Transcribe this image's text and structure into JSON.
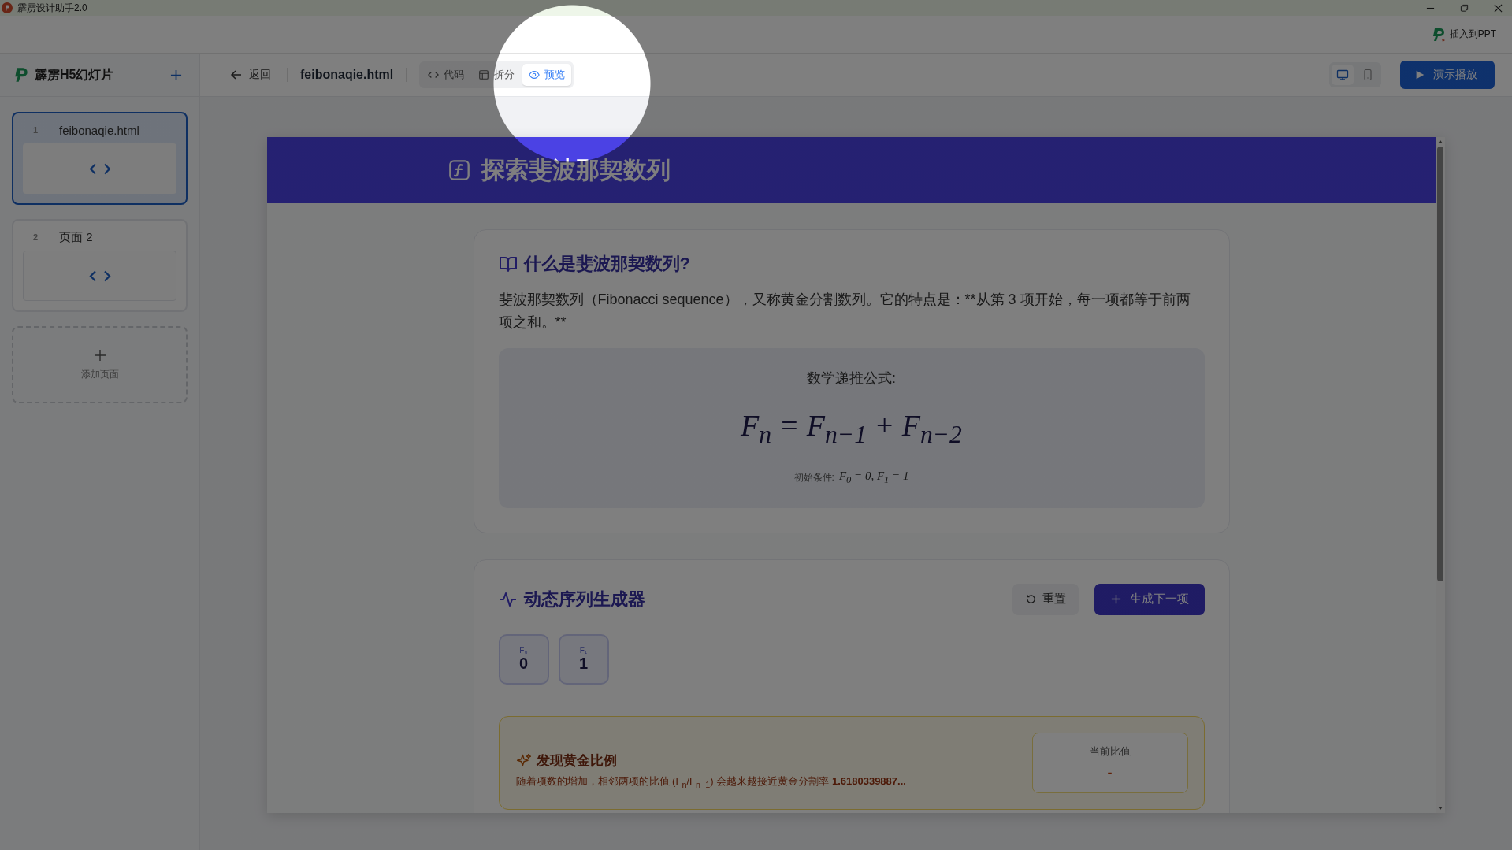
{
  "window": {
    "title": "霹雳设计助手2.0"
  },
  "top_bar": {
    "insert_button": "插入到PPT"
  },
  "sidebar": {
    "title": "霹雳H5幻灯片",
    "pages": [
      {
        "number": "1",
        "name": "feibonaqie.html",
        "selected": true
      },
      {
        "number": "2",
        "name": "页面 2",
        "selected": false
      }
    ],
    "add_page": "添加页面"
  },
  "toolbar": {
    "back": "返回",
    "filename": "feibonaqie.html",
    "view_tabs": [
      {
        "kind": "code",
        "label": "代码",
        "selected": false
      },
      {
        "kind": "split",
        "label": "拆分",
        "selected": false
      },
      {
        "kind": "preview",
        "label": "预览",
        "selected": true
      }
    ],
    "devices": [
      {
        "kind": "desktop",
        "selected": true
      },
      {
        "kind": "mobile",
        "selected": false
      }
    ],
    "play_button": "演示播放"
  },
  "slide": {
    "title": "探索斐波那契数列",
    "intro": {
      "heading": "什么是斐波那契数列?",
      "paragraph": "斐波那契数列（Fibonacci sequence），又称黄金分割数列。它的特点是：**从第 3 项开始，每一项都等于前两项之和。**",
      "formula_label": "数学递推公式:",
      "formula": "F$_{n}$ = F$_{n−1}$ + F$_{n−2}$",
      "initial_label": "初始条件:",
      "initial": "F$_{0}$ = 0, F$_{1}$ = 1"
    },
    "generator": {
      "heading": "动态序列生成器",
      "reset_button": "重置",
      "next_button": "生成下一项",
      "terms": [
        {
          "label": "F₀",
          "value": "0"
        },
        {
          "label": "F₁",
          "value": "1"
        }
      ],
      "golden": {
        "heading": "发现黄金比例",
        "text": "随着项数的增加，相邻两项的比值 (F$_{n}$/F$_{n−1}$) 会越来越接近黄金分割率 **1.6180339887...**",
        "ratio_label": "当前比值",
        "ratio_value": "-"
      }
    }
  }
}
